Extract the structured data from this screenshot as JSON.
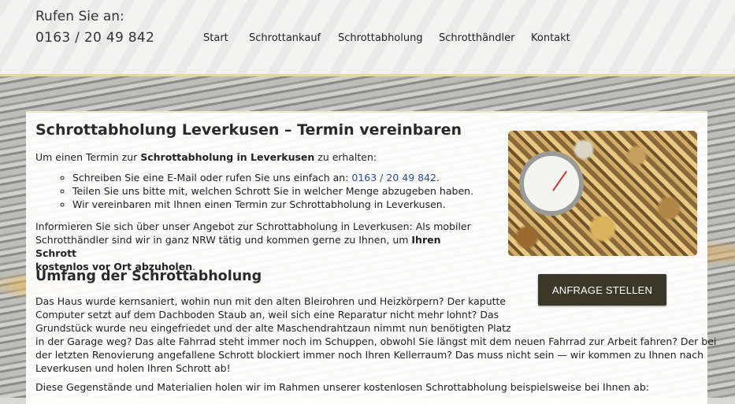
{
  "header": {
    "phone_label": "Rufen Sie an:",
    "phone_number": "0163 / 20 49 842",
    "nav": [
      {
        "label": "Start"
      },
      {
        "label": "Schrottankauf"
      },
      {
        "label": "Schrottabholung"
      },
      {
        "label": "Schrotthändler"
      },
      {
        "label": "Kontakt"
      }
    ]
  },
  "main": {
    "title": "Schrottabholung Leverkusen – Termin vereinbaren",
    "intro_pre": "Um einen Termin zur ",
    "intro_bold": "Schrottabholung in Leverkusen",
    "intro_post": " zu erhalten:",
    "bullets": {
      "b1_pre": "Schreiben Sie eine E-Mail oder rufen Sie uns einfach an: ",
      "b1_link": "0163 / 20 49 842",
      "b1_post": ".",
      "b2": "Teilen Sie uns bitte mit, welchen Schrott Sie in welcher Menge abzugeben haben.",
      "b3": "Wir vereinbaren mit Ihnen einen Termin zur Schrottabholung in Leverkusen."
    },
    "info_line1": "Informieren Sie sich über unser Angebot zur Schrottabholung in Leverkusen: Als mobiler",
    "info_line2_pre": "Schrotthändler sind wir in ganz NRW tätig und kommen gerne zu Ihnen, um ",
    "info_line2_bold": "Ihren Schrott",
    "info_line3_bold": "kostenlos vor Ort abzuholen",
    "info_line3_post": ".",
    "subtitle": "Umfang der Schrottabholung",
    "para1_lines": [
      "Das Haus wurde kernsaniert, wohin nun mit den alten Bleirohren und Heizkörpern? Der kaputte",
      "Computer setzt auf dem Dachboden Staub an, weil sich eine Reparatur nicht mehr lohnt? Das",
      "Grundstück wurde neu eingefriedet und der alte Maschendrahtzaun nimmt nun benötigten Platz",
      "in der Garage weg? Das alte Fahrrad steht immer noch im Schuppen, obwohl Sie längst mit dem neuen Fahrrad zur Arbeit fahren? Der bei",
      "der letzten Renovierung angefallene Schrott blockiert immer noch Ihren Kellerraum? Das muss nicht sein — wir kommen zu Ihnen nach",
      "Leverkusen und holen Ihren Schrott ab!"
    ],
    "para2": "Diese Gegenstände und Materialien holen wir im Rahmen unserer kostenlosen Schrottabholung beispielsweise bei Ihnen ab:"
  },
  "sidebar": {
    "cta_label": "ANFRAGE STELLEN"
  },
  "colors": {
    "cta_bg": "#3b3829",
    "link": "#2e4e8a",
    "header_border": "#e5dd93"
  }
}
